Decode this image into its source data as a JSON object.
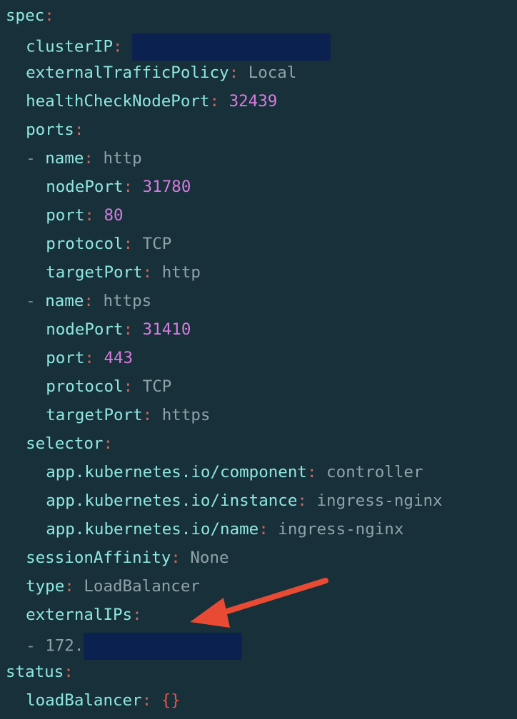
{
  "colors": {
    "background": "#173039",
    "key": "#8fe7e0",
    "colon": "#d0655a",
    "number": "#d77be0",
    "string": "#8fa3a8",
    "redaction": "#0b2150",
    "arrow": "#e94a34"
  },
  "lines": [
    {
      "indent": 0,
      "key": "spec"
    },
    {
      "indent": 1,
      "key": "clusterIP",
      "redacted": true,
      "redactWidth": 278
    },
    {
      "indent": 1,
      "key": "externalTrafficPolicy",
      "value": "Local",
      "vtype": "str"
    },
    {
      "indent": 1,
      "key": "healthCheckNodePort",
      "value": "32439",
      "vtype": "num"
    },
    {
      "indent": 1,
      "key": "ports"
    },
    {
      "indent": 1,
      "dash": true,
      "key": "name",
      "value": "http",
      "vtype": "str"
    },
    {
      "indent": 2,
      "key": "nodePort",
      "value": "31780",
      "vtype": "num"
    },
    {
      "indent": 2,
      "key": "port",
      "value": "80",
      "vtype": "num"
    },
    {
      "indent": 2,
      "key": "protocol",
      "value": "TCP",
      "vtype": "str"
    },
    {
      "indent": 2,
      "key": "targetPort",
      "value": "http",
      "vtype": "str"
    },
    {
      "indent": 1,
      "dash": true,
      "key": "name",
      "value": "https",
      "vtype": "str"
    },
    {
      "indent": 2,
      "key": "nodePort",
      "value": "31410",
      "vtype": "num"
    },
    {
      "indent": 2,
      "key": "port",
      "value": "443",
      "vtype": "num"
    },
    {
      "indent": 2,
      "key": "protocol",
      "value": "TCP",
      "vtype": "str"
    },
    {
      "indent": 2,
      "key": "targetPort",
      "value": "https",
      "vtype": "str"
    },
    {
      "indent": 1,
      "key": "selector"
    },
    {
      "indent": 2,
      "key": "app.kubernetes.io/component",
      "value": "controller",
      "vtype": "str"
    },
    {
      "indent": 2,
      "key": "app.kubernetes.io/instance",
      "value": "ingress-nginx",
      "vtype": "str"
    },
    {
      "indent": 2,
      "key": "app.kubernetes.io/name",
      "value": "ingress-nginx",
      "vtype": "str"
    },
    {
      "indent": 1,
      "key": "sessionAffinity",
      "value": "None",
      "vtype": "str"
    },
    {
      "indent": 1,
      "key": "type",
      "value": "LoadBalancer",
      "vtype": "str"
    },
    {
      "indent": 1,
      "key": "externalIPs"
    },
    {
      "indent": 1,
      "dash": true,
      "item": "172.",
      "redacted": true,
      "redactWidth": 222
    },
    {
      "indent": 0,
      "key": "status"
    },
    {
      "indent": 1,
      "key": "loadBalancer",
      "value": "{}",
      "vtype": "brace"
    }
  ]
}
